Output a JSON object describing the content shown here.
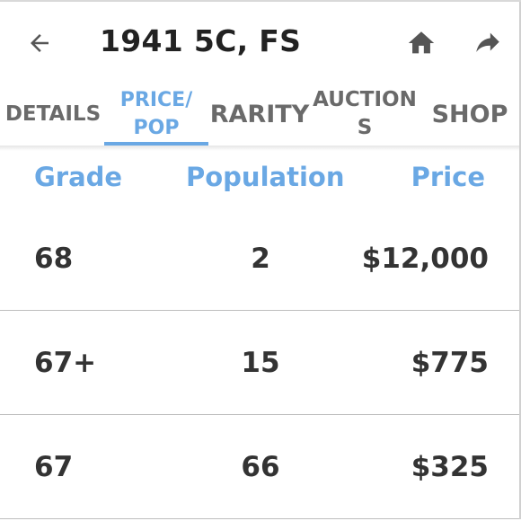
{
  "app_bar": {
    "title": "1941 5C, FS"
  },
  "tabs": [
    {
      "label": "DETAILS",
      "active": false
    },
    {
      "label": "PRICE/\nPOP",
      "active": true
    },
    {
      "label": "RARITY",
      "active": false
    },
    {
      "label": "AUCTION\nS",
      "active": false
    },
    {
      "label": "SHOP",
      "active": false
    }
  ],
  "table": {
    "headers": {
      "grade": "Grade",
      "population": "Population",
      "price": "Price"
    },
    "rows": [
      {
        "grade": "68",
        "population": "2",
        "price": "$12,000"
      },
      {
        "grade": "67+",
        "population": "15",
        "price": "$775"
      },
      {
        "grade": "67",
        "population": "66",
        "price": "$325"
      }
    ]
  },
  "colors": {
    "accent": "#6aa8e4",
    "text_dark": "#333333",
    "tab_inactive": "#6a6a6a"
  },
  "icons": {
    "back": "arrow-back-icon",
    "home": "home-icon",
    "share": "share-icon"
  }
}
